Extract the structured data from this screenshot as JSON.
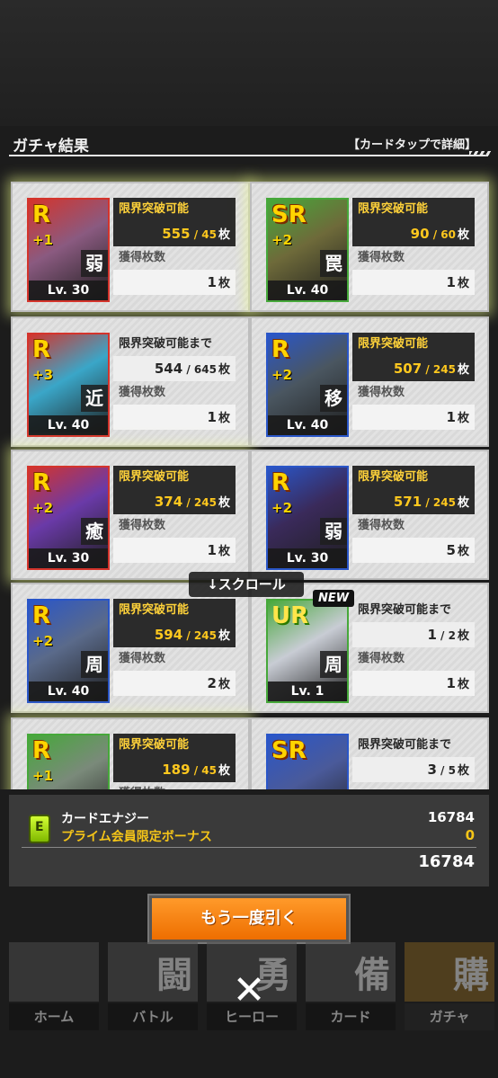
{
  "header": {
    "title": "ガチャ結果",
    "hint": "【カードタップで詳細】"
  },
  "cards": [
    {
      "rarity": "R",
      "plus": "+1",
      "kanji": "弱",
      "level": "Lv. 30",
      "status": "限界突破可能",
      "owned": "555",
      "need": "45",
      "unit": "枚",
      "count_label": "獲得枚数",
      "count": "1",
      "count_unit": "枚",
      "art": "#8a5a80",
      "frame": "#d4342c",
      "glow": true
    },
    {
      "rarity": "SR",
      "plus": "+2",
      "kanji": "罠",
      "level": "Lv. 40",
      "status": "限界突破可能",
      "owned": "90",
      "need": "60",
      "unit": "枚",
      "count_label": "獲得枚数",
      "count": "1",
      "count_unit": "枚",
      "art": "#6e6a3a",
      "frame": "#46a83a",
      "glow": true
    },
    {
      "rarity": "R",
      "plus": "+3",
      "kanji": "近",
      "level": "Lv. 40",
      "status": "限界突破可能まで",
      "owned": "544",
      "need": "645",
      "unit": "枚",
      "count_label": "獲得枚数",
      "count": "1",
      "count_unit": "枚",
      "art": "#3aa6c8",
      "frame": "#d4342c",
      "glow": false
    },
    {
      "rarity": "R",
      "plus": "+2",
      "kanji": "移",
      "level": "Lv. 40",
      "status": "限界突破可能",
      "owned": "507",
      "need": "245",
      "unit": "枚",
      "count_label": "獲得枚数",
      "count": "1",
      "count_unit": "枚",
      "art": "#4a5660",
      "frame": "#2a56c8",
      "glow": false
    },
    {
      "rarity": "R",
      "plus": "+2",
      "kanji": "癒",
      "level": "Lv. 30",
      "status": "限界突破可能",
      "owned": "374",
      "need": "245",
      "unit": "枚",
      "count_label": "獲得枚数",
      "count": "1",
      "count_unit": "枚",
      "art": "#6a3aa8",
      "frame": "#d4342c",
      "glow": true
    },
    {
      "rarity": "R",
      "plus": "+2",
      "kanji": "弱",
      "level": "Lv. 30",
      "status": "限界突破可能",
      "owned": "571",
      "need": "245",
      "unit": "枚",
      "count_label": "獲得枚数",
      "count": "5",
      "count_unit": "枚",
      "art": "#3a2a5a",
      "frame": "#2a56c8",
      "glow": false
    },
    {
      "rarity": "R",
      "plus": "+2",
      "kanji": "周",
      "level": "Lv. 40",
      "status": "限界突破可能",
      "owned": "594",
      "need": "245",
      "unit": "枚",
      "count_label": "獲得枚数",
      "count": "2",
      "count_unit": "枚",
      "art": "#5a6a8a",
      "frame": "#2a56c8",
      "glow": false
    },
    {
      "rarity": "UR",
      "plus": "",
      "kanji": "周",
      "level": "Lv. 1",
      "status": "限界突破可能まで",
      "owned": "1",
      "need": "2",
      "unit": "枚",
      "count_label": "獲得枚数",
      "count": "1",
      "count_unit": "枚",
      "art": "#c8ccd4",
      "frame": "#46a83a",
      "glow": false,
      "new": "NEW"
    },
    {
      "rarity": "R",
      "plus": "+1",
      "kanji": "",
      "level": "",
      "status": "限界突破可能",
      "owned": "189",
      "need": "45",
      "unit": "枚",
      "count_label": "獲得枚数",
      "count": "",
      "count_unit": "",
      "art": "#7a8a7a",
      "frame": "#46a83a",
      "glow": true
    },
    {
      "rarity": "SR",
      "plus": "",
      "kanji": "",
      "level": "",
      "status": "限界突破可能まで",
      "owned": "3",
      "need": "5",
      "unit": "枚",
      "count_label": "",
      "count": "",
      "count_unit": "",
      "art": "#4a5a9a",
      "frame": "#2a56c8",
      "glow": false
    }
  ],
  "scroll_hint": "↓スクロール",
  "energy": {
    "label": "カードエナジー",
    "bonus_label": "プライム会員限定ボーナス",
    "value": "16784",
    "bonus_value": "0",
    "total": "16784"
  },
  "again_button": "もう一度引く",
  "nav": [
    {
      "label": "ホーム",
      "glyph": "",
      "active": false
    },
    {
      "label": "バトル",
      "glyph": "闘",
      "active": false
    },
    {
      "label": "ヒーロー",
      "glyph": "勇",
      "active": false
    },
    {
      "label": "カード",
      "glyph": "備",
      "active": false
    },
    {
      "label": "ガチャ",
      "glyph": "購",
      "active": true
    }
  ],
  "close_glyph": "✕",
  "colors": {
    "accent": "#f5c518",
    "button": "#ff8a1a",
    "panel": "#3a3a3a"
  }
}
